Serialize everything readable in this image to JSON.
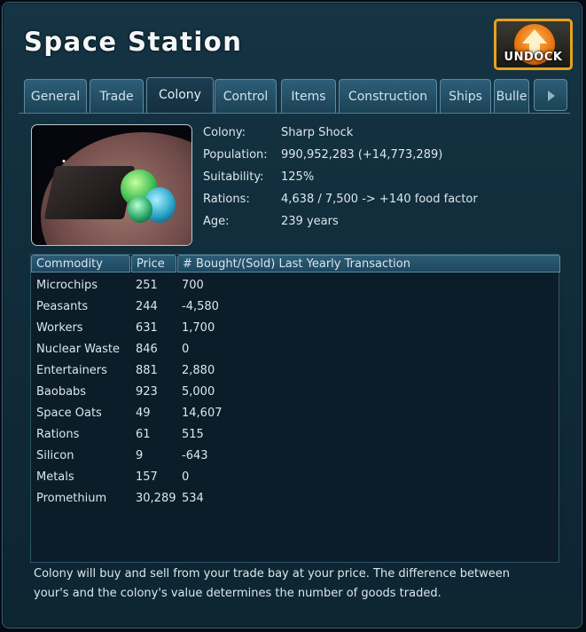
{
  "title": "Space Station",
  "undock_label": "UNDOCK",
  "tabs": [
    {
      "label": "General"
    },
    {
      "label": "Trade"
    },
    {
      "label": "Colony"
    },
    {
      "label": "Control"
    },
    {
      "label": "Items"
    },
    {
      "label": "Construction"
    },
    {
      "label": "Ships"
    },
    {
      "label": "Bulle"
    }
  ],
  "active_tab": "Colony",
  "colony_info": [
    {
      "label": "Colony:",
      "value": "Sharp Shock"
    },
    {
      "label": "Population:",
      "value": "990,952,283 (+14,773,289)"
    },
    {
      "label": "Suitability:",
      "value": "125%"
    },
    {
      "label": "Rations:",
      "value": "4,638 / 7,500 -> +140 food factor"
    },
    {
      "label": "Age:",
      "value": "239 years"
    }
  ],
  "table": {
    "headers": [
      "Commodity",
      "Price",
      "# Bought/(Sold) Last Yearly Transaction"
    ],
    "rows": [
      [
        "Microchips",
        "251",
        "700"
      ],
      [
        "Peasants",
        "244",
        "-4,580"
      ],
      [
        "Workers",
        "631",
        "1,700"
      ],
      [
        "Nuclear Waste",
        "846",
        "0"
      ],
      [
        "Entertainers",
        "881",
        "2,880"
      ],
      [
        "Baobabs",
        "923",
        "5,000"
      ],
      [
        "Space Oats",
        "49",
        "14,607"
      ],
      [
        "Rations",
        "61",
        "515"
      ],
      [
        "Silicon",
        "9",
        "-643"
      ],
      [
        "Metals",
        "157",
        "0"
      ],
      [
        "Promethium",
        "30,289",
        "534"
      ]
    ]
  },
  "footer_lines": [
    "Colony will buy and sell from your trade bay at your price. The difference between",
    "your's and the colony's value determines the number of goods traded."
  ],
  "colors": {
    "accent": "#e6a21c",
    "panel": "#153444",
    "text": "#dbe6ec"
  }
}
